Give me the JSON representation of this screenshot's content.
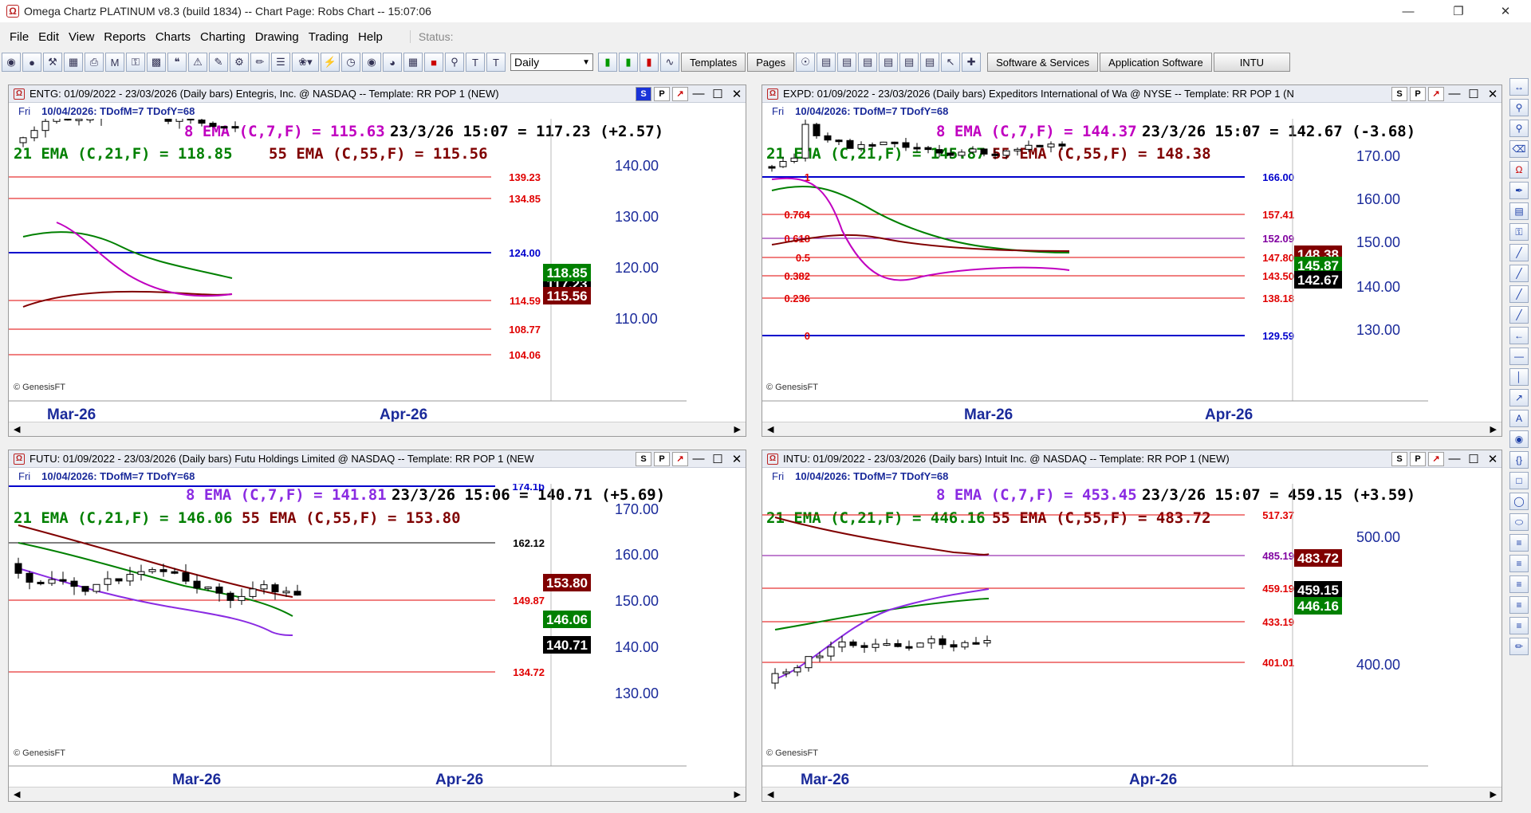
{
  "window": {
    "title": "Omega Chartz PLATINUM v8.3 (build 1834)  --  Chart Page: Robs Chart -- 15:07:06",
    "app_icon": "Ω"
  },
  "menu": {
    "items": [
      "File",
      "Edit",
      "View",
      "Reports",
      "Charts",
      "Charting",
      "Drawing",
      "Trading",
      "Help"
    ],
    "status_label": "Status:"
  },
  "toolbar": {
    "period_value": "Daily",
    "buttons": [
      "Templates",
      "Pages",
      "Software & Services",
      "Application Software",
      "INTU"
    ]
  },
  "panels": [
    {
      "symbol": "ENTG",
      "header": "ENTG: 01/09/2022 - 23/03/2026  (Daily bars)   Entegris, Inc. @ NASDAQ  --  Template: RR POP 1 (NEW)",
      "sub_day": "Fri",
      "sub_info": "10/04/2026:  TDofM=7  TDofY=68",
      "ema8": "8 EMA (C,7,F) = 115.63",
      "quote": "23/3/26 15:07 = 117.23 (+2.57)",
      "ema21": "21 EMA (C,21,F) = 118.85",
      "ema55": "55 EMA (C,55,F) = 115.56",
      "copyright": "© GenesisFT",
      "x_labels": [
        "Mar-26",
        "Apr-26"
      ],
      "y_ticks": [
        "140.00",
        "130.00",
        "120.00",
        "110.00"
      ],
      "level_labels": [
        "139.23",
        "134.85",
        "124.00",
        "114.59",
        "108.77",
        "104.06"
      ],
      "price_tags": [
        "117.23",
        "115.56",
        "118.85"
      ]
    },
    {
      "symbol": "EXPD",
      "header": "EXPD: 01/09/2022 - 23/03/2026  (Daily bars)   Expeditors International of Wa @ NYSE  --  Template: RR POP 1 (N",
      "sub_day": "Fri",
      "sub_info": "10/04/2026:  TDofM=7  TDofY=68",
      "ema8": "8 EMA (C,7,F) = 144.37",
      "quote": "23/3/26 15:07 = 142.67 (-3.68)",
      "ema21": "21 EMA (C,21,F) = 145.87",
      "ema55": "55 EMA (C,55,F) = 148.38",
      "copyright": "© GenesisFT",
      "x_labels": [
        "Mar-26",
        "Apr-26"
      ],
      "y_ticks": [
        "170.00",
        "160.00",
        "150.00",
        "140.00",
        "130.00"
      ],
      "level_labels": [
        "166.00",
        "157.41",
        "152.09",
        "147.80",
        "143.50",
        "138.18",
        "129.59"
      ],
      "fib_labels": [
        "1",
        "0.764",
        "0.618",
        "0.5",
        "0.382",
        "0.236",
        "0"
      ],
      "price_tags": [
        "148.38",
        "145.87",
        "142.67"
      ]
    },
    {
      "symbol": "FUTU",
      "header": "FUTU: 01/09/2022 - 23/03/2026  (Daily bars)   Futu Holdings Limited @ NASDAQ  --  Template: RR POP 1 (NEW",
      "sub_day": "Fri",
      "sub_info": "10/04/2026:  TDofM=7  TDofY=68",
      "ema8": "8 EMA (C,7,F) = 141.81",
      "quote": "23/3/26 15:06 = 140.71 (+5.69)",
      "ema21": "21 EMA (C,21,F) = 146.06",
      "ema55": "55 EMA (C,55,F) = 153.80",
      "copyright": "© GenesisFT",
      "x_labels": [
        "Mar-26",
        "Apr-26"
      ],
      "y_ticks": [
        "170.00",
        "160.00",
        "150.00",
        "140.00",
        "130.00"
      ],
      "level_labels": [
        "174.1b",
        "162.12",
        "149.87",
        "134.72"
      ],
      "price_tags": [
        "153.80",
        "146.06",
        "140.71"
      ]
    },
    {
      "symbol": "INTU",
      "header": "INTU: 01/09/2022 - 23/03/2026  (Daily bars)   Intuit Inc. @ NASDAQ  --  Template: RR POP 1 (NEW)",
      "sub_day": "Fri",
      "sub_info": "10/04/2026:  TDofM=7  TDofY=68",
      "ema8": "8 EMA (C,7,F) = 453.45",
      "quote": "23/3/26 15:07 = 459.15 (+3.59)",
      "ema21": "21 EMA (C,21,F) = 446.16",
      "ema55": "55 EMA (C,55,F) = 483.72",
      "copyright": "© GenesisFT",
      "x_labels": [
        "Mar-26",
        "Apr-26"
      ],
      "y_ticks": [
        "500.00",
        "400.00"
      ],
      "level_labels": [
        "517.37",
        "485.19",
        "459.19",
        "433.19",
        "401.01"
      ],
      "price_tags": [
        "483.72",
        "459.15",
        "446.16"
      ]
    }
  ],
  "colors": {
    "ema8": "#c000c0",
    "ema21": "#008000",
    "ema55": "#800000",
    "level_red": "#e00000",
    "level_blue": "#0000cc",
    "fib_purple": "#8000a0",
    "axis_blue": "#1a2a9a"
  },
  "icons": [
    "app-omega-icon",
    "minimize-icon",
    "maximize-icon",
    "close-icon"
  ]
}
